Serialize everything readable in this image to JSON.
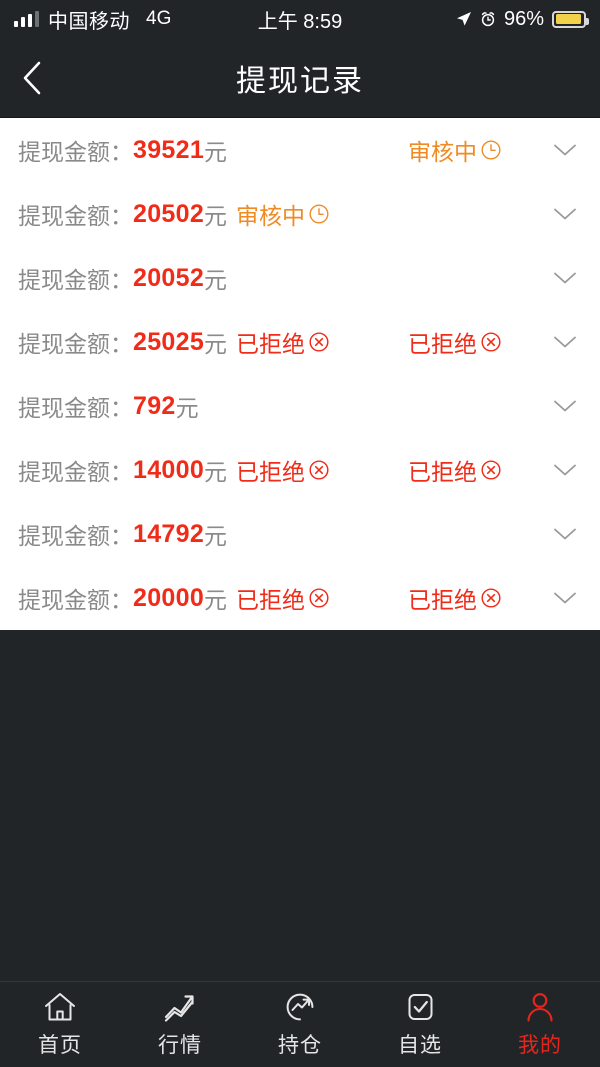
{
  "statusbar": {
    "carrier": "中国移动",
    "network": "4G",
    "time": "上午 8:59",
    "battery_percent": "96%",
    "signal_bars": 3,
    "signal_bars_total": 4,
    "icons": [
      "location-arrow-icon",
      "alarm-clock-icon",
      "battery-icon"
    ],
    "battery_color": "#f2d24b"
  },
  "navbar": {
    "title": "提现记录",
    "back_icon": "chevron-left-icon"
  },
  "list": {
    "label": "提现金额：",
    "unit": "元",
    "status_pending_text": "审核中",
    "status_rejected_text": "已拒绝",
    "status_pending_color": "#f08b24",
    "status_rejected_color": "#f02c19",
    "amount_color": "#f02c19",
    "rows": [
      {
        "amount": "39521",
        "inline_status": "",
        "right_status": "审核中",
        "status_type": "pending",
        "expand_icon": "chevron-down-icon"
      },
      {
        "amount": "20502",
        "inline_status": "审核中",
        "right_status": "",
        "status_type": "pending",
        "expand_icon": "chevron-down-icon"
      },
      {
        "amount": "20052",
        "inline_status": "",
        "right_status": "",
        "status_type": "none",
        "expand_icon": "chevron-down-icon"
      },
      {
        "amount": "25025",
        "inline_status": "已拒绝",
        "right_status": "已拒绝",
        "status_type": "rejected",
        "expand_icon": "chevron-down-icon"
      },
      {
        "amount": "792",
        "inline_status": "",
        "right_status": "",
        "status_type": "none",
        "expand_icon": "chevron-down-icon"
      },
      {
        "amount": "14000",
        "inline_status": "已拒绝",
        "right_status": "已拒绝",
        "status_type": "rejected",
        "expand_icon": "chevron-down-icon"
      },
      {
        "amount": "14792",
        "inline_status": "",
        "right_status": "",
        "status_type": "none",
        "expand_icon": "chevron-down-icon"
      },
      {
        "amount": "20000",
        "inline_status": "已拒绝",
        "right_status": "已拒绝",
        "status_type": "rejected",
        "expand_icon": "chevron-down-icon"
      }
    ]
  },
  "tabbar": {
    "active_color": "#e8251c",
    "inactive_color": "#e6e6e6",
    "tabs": [
      {
        "label": "首页",
        "icon": "home-icon",
        "active": false
      },
      {
        "label": "行情",
        "icon": "line-chart-icon",
        "active": false
      },
      {
        "label": "持仓",
        "icon": "trend-circle-icon",
        "active": false
      },
      {
        "label": "自选",
        "icon": "checkbox-icon",
        "active": false
      },
      {
        "label": "我的",
        "icon": "person-icon",
        "active": true
      }
    ]
  }
}
